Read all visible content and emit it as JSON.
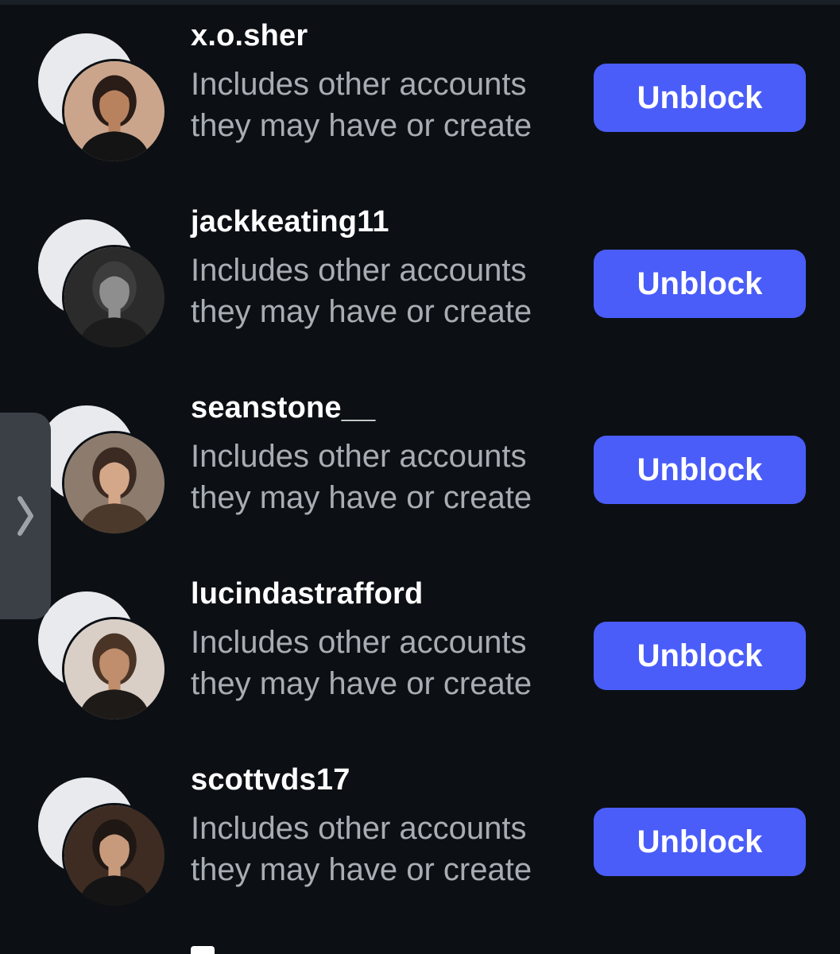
{
  "blocked_list": {
    "items": [
      {
        "username": "x.o.sher",
        "subtitle": "Includes other accounts they may have or create",
        "button_label": "Unblock",
        "avatar": {
          "bg": "#caa58c",
          "skin": "#b9825f",
          "hair": "#2a1c16",
          "cloth": "#141414"
        }
      },
      {
        "username": "jackkeating11",
        "subtitle": "Includes other accounts they may have or create",
        "button_label": "Unblock",
        "avatar": {
          "bg": "#2b2b2b",
          "skin": "#8e8e8e",
          "hair": "#3d3d3d",
          "cloth": "#1c1c1c"
        }
      },
      {
        "username": "seanstone__",
        "subtitle": "Includes other accounts they may have or create",
        "button_label": "Unblock",
        "avatar": {
          "bg": "#8d7c6e",
          "skin": "#d5a789",
          "hair": "#3a2a22",
          "cloth": "#4b3a2c"
        }
      },
      {
        "username": "lucindastrafford",
        "subtitle": "Includes other accounts they may have or create",
        "button_label": "Unblock",
        "avatar": {
          "bg": "#d9cfc7",
          "skin": "#c08e6c",
          "hair": "#4a3426",
          "cloth": "#1e1a17"
        }
      },
      {
        "username": "scottvds17",
        "subtitle": "Includes other accounts they may have or create",
        "button_label": "Unblock",
        "avatar": {
          "bg": "#3e2c22",
          "skin": "#c79a7c",
          "hair": "#1f1713",
          "cloth": "#141414"
        }
      }
    ]
  },
  "side_handle": {
    "icon": "chevron-right-icon"
  },
  "colors": {
    "background": "#0c1014",
    "button": "#4a5df9",
    "subtitle": "#a8adb4",
    "handle": "#3b3f46"
  }
}
